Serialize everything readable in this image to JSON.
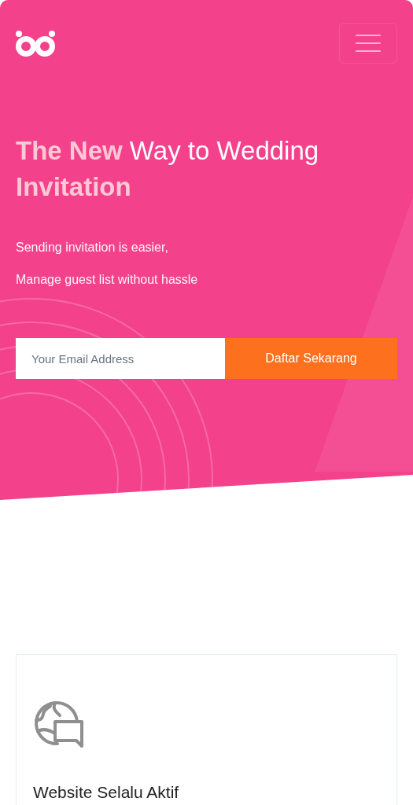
{
  "hero": {
    "heading": "**The New** Way to Wedding **Invitation**",
    "subtitle_lines": [
      "Sending invitation is easier,",
      "Manage guest list without hassle"
    ],
    "signup": {
      "placeholder": "Your Email Address",
      "button": "Daftar Sekarang"
    }
  },
  "features": [
    {
      "title": "Website Selalu Aktif"
    }
  ]
}
